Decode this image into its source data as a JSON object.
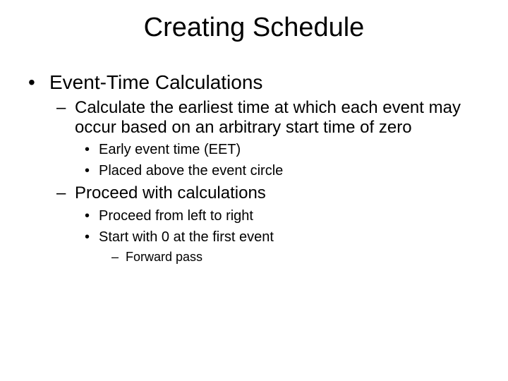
{
  "title": "Creating Schedule",
  "l1_a": "Event-Time Calculations",
  "l2_a": "Calculate the earliest time at which each event may occur based on an arbitrary start time of zero",
  "l3_a1": "Early event time (EET)",
  "l3_a2": "Placed above the event circle",
  "l2_b": "Proceed with calculations",
  "l3_b1": "Proceed from left to right",
  "l3_b2": "Start with 0 at the first event",
  "l4_b2a": "Forward pass"
}
